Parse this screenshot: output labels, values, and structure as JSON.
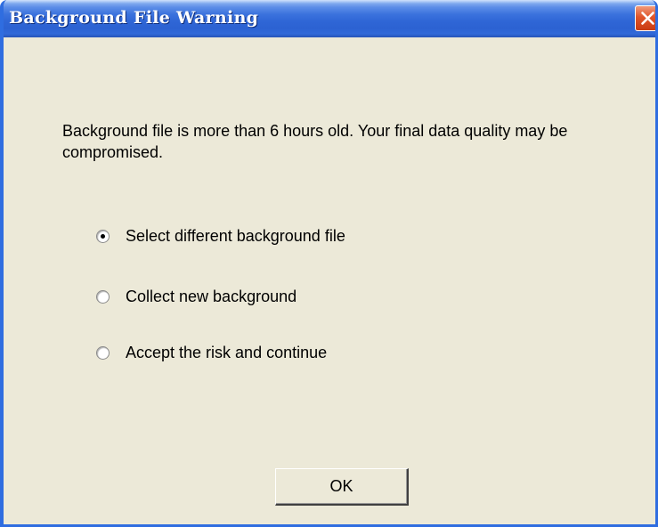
{
  "window": {
    "title": "Background File Warning"
  },
  "message": "Background file is more than 6 hours old.  Your final data quality may be compromised.",
  "options": [
    {
      "label": "Select different background file",
      "checked": true
    },
    {
      "label": "Collect new background",
      "checked": false
    },
    {
      "label": "Accept the risk and continue",
      "checked": false
    }
  ],
  "ok_button": {
    "label": "OK"
  },
  "colors": {
    "titlebar": "#2f66d6",
    "dialog_background": "#ece9d8",
    "close_button": "#e0552a"
  },
  "icons": {
    "close": "close-icon"
  }
}
